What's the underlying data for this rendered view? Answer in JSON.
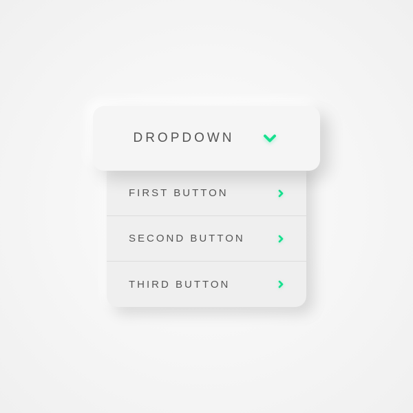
{
  "dropdown": {
    "label": "DROPDOWN",
    "icon": "chevron-down",
    "accent_color": "#16e08e",
    "items": [
      {
        "label": "FIRST BUTTON",
        "icon": "chevron-right"
      },
      {
        "label": "SECOND BUTTON",
        "icon": "chevron-right"
      },
      {
        "label": "THIRD BUTTON",
        "icon": "chevron-right"
      }
    ]
  }
}
